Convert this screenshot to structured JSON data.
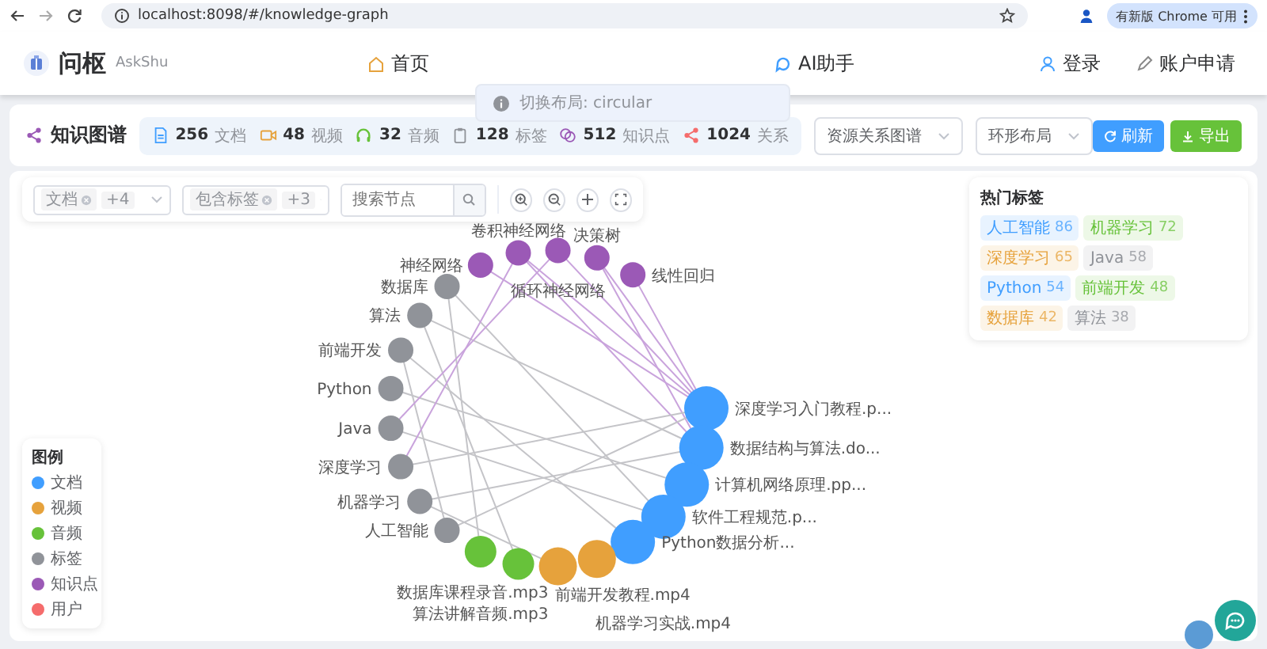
{
  "browser": {
    "url": "localhost:8098/#/knowledge-graph",
    "update_button": "有新版 Chrome 可用"
  },
  "header": {
    "brand": "问枢",
    "brand_sub": "AskShu",
    "nav": [
      {
        "label": "首页",
        "kind": "home",
        "selected": false
      },
      {
        "label": "AI助手",
        "kind": "ai",
        "selected": false
      }
    ],
    "account": [
      {
        "label": "登录",
        "kind": "login"
      },
      {
        "label": "账户申请",
        "kind": "apply"
      }
    ]
  },
  "toast": {
    "text": "切换布局: circular"
  },
  "page": {
    "title": "知识图谱",
    "stats": [
      {
        "value": "256",
        "label": "文档",
        "kind": "doc"
      },
      {
        "value": "48",
        "label": "视频",
        "kind": "video"
      },
      {
        "value": "32",
        "label": "音频",
        "kind": "audio"
      },
      {
        "value": "128",
        "label": "标签",
        "kind": "tag"
      },
      {
        "value": "512",
        "label": "知识点",
        "kind": "knowledge"
      },
      {
        "value": "1024",
        "label": "关系",
        "kind": "relation"
      }
    ],
    "selects": [
      {
        "value": "资源关系图谱"
      },
      {
        "value": "环形布局"
      }
    ],
    "buttons": [
      {
        "label": "刷新",
        "kind": "refresh"
      },
      {
        "label": "导出",
        "kind": "export"
      }
    ]
  },
  "filters": {
    "type_filter": {
      "tag": "文档",
      "more": "+4"
    },
    "tag_filter": {
      "tag": "包含标签",
      "more": "+3"
    },
    "search": {
      "placeholder": "搜索节点"
    }
  },
  "hot_tags": {
    "title": "热门标签",
    "tags": [
      {
        "label": "人工智能",
        "count": "86",
        "color": "#409eff"
      },
      {
        "label": "机器学习",
        "count": "72",
        "color": "#67c23a"
      },
      {
        "label": "深度学习",
        "count": "65",
        "color": "#e6a23c"
      },
      {
        "label": "Java",
        "count": "58",
        "color": "#909399"
      },
      {
        "label": "Python",
        "count": "54",
        "color": "#409eff"
      },
      {
        "label": "前端开发",
        "count": "48",
        "color": "#67c23a"
      },
      {
        "label": "数据库",
        "count": "42",
        "color": "#e6a23c"
      },
      {
        "label": "算法",
        "count": "38",
        "color": "#909399"
      }
    ]
  },
  "legend": {
    "title": "图例",
    "items": [
      {
        "label": "文档",
        "color": "#409eff"
      },
      {
        "label": "视频",
        "color": "#e6a23c"
      },
      {
        "label": "音频",
        "color": "#67c23a"
      },
      {
        "label": "标签",
        "color": "#909399"
      },
      {
        "label": "知识点",
        "color": "#9b59b6"
      },
      {
        "label": "用户",
        "color": "#f56c6c"
      }
    ]
  },
  "graph": {
    "nodes": [
      {
        "label": "神经网络",
        "kind": "knowledge"
      },
      {
        "label": "卷积神经网络",
        "kind": "knowledge"
      },
      {
        "label": "循环神经网络",
        "kind": "knowledge"
      },
      {
        "label": "决策树",
        "kind": "knowledge"
      },
      {
        "label": "线性回归",
        "kind": "knowledge"
      },
      {
        "label": "数据库",
        "kind": "tag"
      },
      {
        "label": "算法",
        "kind": "tag"
      },
      {
        "label": "前端开发",
        "kind": "tag"
      },
      {
        "label": "Python",
        "kind": "tag"
      },
      {
        "label": "Java",
        "kind": "tag"
      },
      {
        "label": "深度学习",
        "kind": "tag"
      },
      {
        "label": "机器学习",
        "kind": "tag"
      },
      {
        "label": "人工智能",
        "kind": "tag"
      },
      {
        "label": "深度学习入门教程.p...",
        "kind": "doc"
      },
      {
        "label": "数据结构与算法.do...",
        "kind": "doc"
      },
      {
        "label": "计算机网络原理.pp...",
        "kind": "doc"
      },
      {
        "label": "软件工程规范.p...",
        "kind": "doc"
      },
      {
        "label": "Python数据分析...",
        "kind": "doc"
      },
      {
        "label": "数据库课程录音.mp3",
        "kind": "audio"
      },
      {
        "label": "算法讲解音频.mp3",
        "kind": "audio"
      },
      {
        "label": "前端开发教程.mp4",
        "kind": "video"
      },
      {
        "label": "机器学习实战.mp4",
        "kind": "video"
      }
    ]
  }
}
